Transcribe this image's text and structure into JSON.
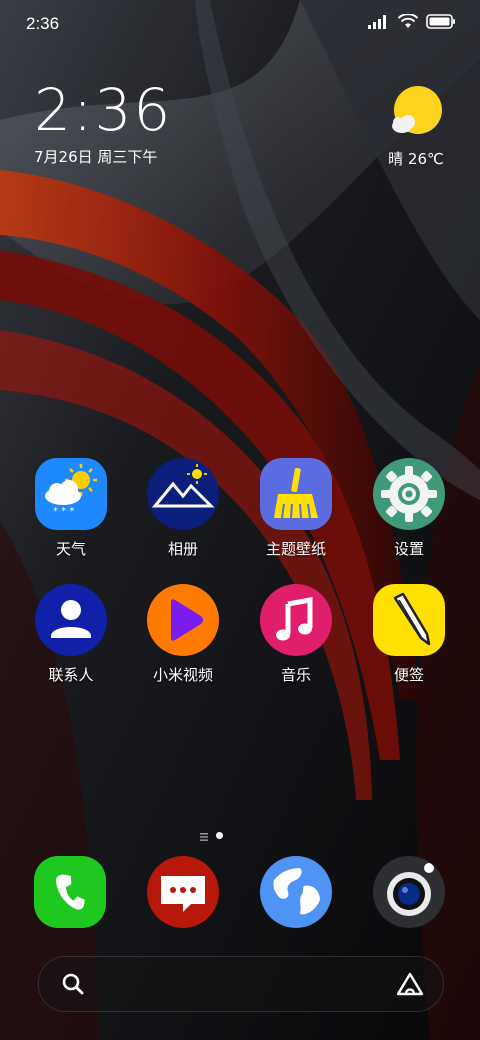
{
  "status_bar": {
    "time": "2:36",
    "battery_icon": "battery-icon",
    "wifi_icon": "wifi-icon",
    "signal_icon": "signal-icon"
  },
  "clock": {
    "time": "2:36",
    "date": "7月26日 周三下午"
  },
  "weather": {
    "text": "晴 26℃",
    "icon": "sun-cloud-icon"
  },
  "apps": [
    {
      "label": "天气",
      "icon": "weather-icon",
      "color": "#1e88ff"
    },
    {
      "label": "相册",
      "icon": "gallery-icon",
      "color": "#0a1e7a"
    },
    {
      "label": "主题壁纸",
      "icon": "broom-icon",
      "color": "#5b6be0"
    },
    {
      "label": "设置",
      "icon": "gear-icon",
      "color": "#3e9a78"
    },
    {
      "label": "联系人",
      "icon": "contacts-icon",
      "color": "#1020a8"
    },
    {
      "label": "小米视频",
      "icon": "play-icon",
      "color": "#ff7a00"
    },
    {
      "label": "音乐",
      "icon": "music-note-icon",
      "color": "#e01e6a"
    },
    {
      "label": "便签",
      "icon": "pencil-icon",
      "color": "#ffe000"
    }
  ],
  "dock": [
    {
      "name": "phone",
      "icon": "phone-icon",
      "color": "#1ec81e"
    },
    {
      "name": "messages",
      "icon": "message-icon",
      "color": "#b8180c"
    },
    {
      "name": "browser",
      "icon": "globe-icon",
      "color": "#4f94f5"
    },
    {
      "name": "camera",
      "icon": "camera-icon",
      "color": "#2d2f33"
    }
  ],
  "page_indicator": {
    "pages": 2,
    "current": 2
  }
}
